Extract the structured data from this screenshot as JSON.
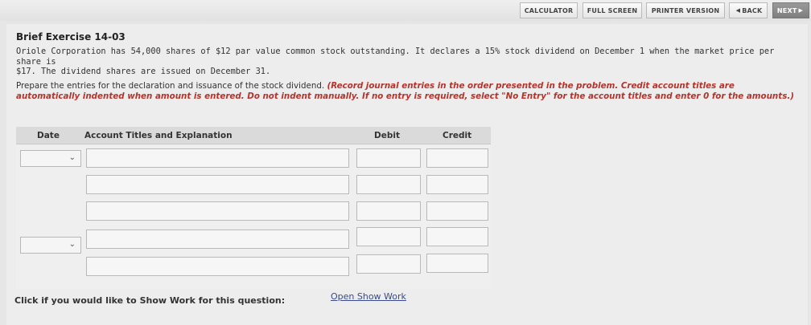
{
  "toolbar": {
    "calculator": "CALCULATOR",
    "full_screen": "FULL SCREEN",
    "printer_version": "PRINTER VERSION",
    "back": "BACK",
    "next": "NEXT"
  },
  "exercise": {
    "title": "Brief Exercise 14-03",
    "problem_line1": "Oriole Corporation has 54,000 shares of $12 par value common stock outstanding. It declares a 15% stock dividend on December 1 when the market price per share is",
    "problem_line2": "$17. The dividend shares are issued on December 31.",
    "instruction_plain": "Prepare the entries for the declaration and issuance of the stock dividend. ",
    "instruction_red": "(Record journal entries in the order presented in the problem. Credit account titles are automatically indented when amount is entered. Do not indent manually. If no entry is required, select \"No Entry\" for the account titles and enter 0 for the amounts.)"
  },
  "table": {
    "headers": {
      "date": "Date",
      "account": "Account Titles and Explanation",
      "debit": "Debit",
      "credit": "Credit"
    },
    "rows": [
      {
        "date": "",
        "account": "",
        "debit": "",
        "credit": ""
      },
      {
        "account": "",
        "debit": "",
        "credit": ""
      },
      {
        "account": "",
        "debit": "",
        "credit": ""
      },
      {
        "date": "",
        "account": "",
        "debit": "",
        "credit": ""
      },
      {
        "account": "",
        "debit": "",
        "credit": ""
      }
    ]
  },
  "show_work": {
    "label": "Click if you would like to Show Work for this question:",
    "link": "Open Show Work"
  },
  "icons": {
    "back": "caret-left-icon",
    "next": "caret-right-icon",
    "dropdown": "chevron-down-icon"
  }
}
